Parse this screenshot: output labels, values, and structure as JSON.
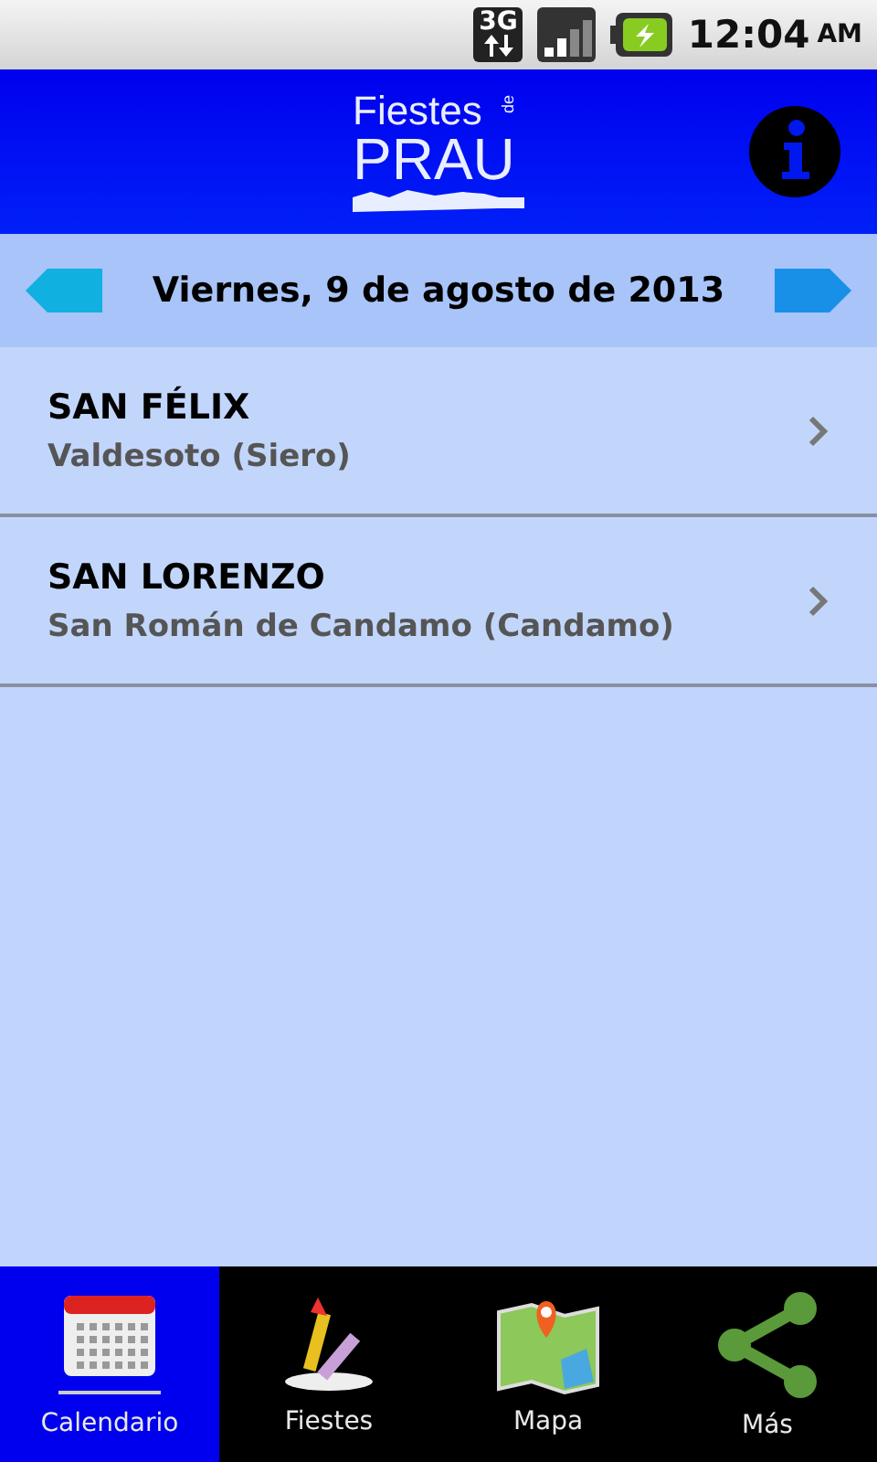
{
  "status_bar": {
    "network": "3G",
    "time": "12:04",
    "meridiem": "AM"
  },
  "header": {
    "logo": {
      "top": "Fiestes",
      "small": "de",
      "bottom": "PRAU"
    }
  },
  "date_bar": {
    "date": "Viernes, 9 de agosto de 2013"
  },
  "events": [
    {
      "name": "SAN FÉLIX",
      "place": "Valdesoto (Siero)"
    },
    {
      "name": "SAN LORENZO",
      "place": "San Román de Candamo (Candamo)"
    }
  ],
  "tabs": [
    {
      "kind": "calendar",
      "label": "Calendario",
      "selected": true
    },
    {
      "kind": "rocket",
      "label": "Fiestes",
      "selected": false
    },
    {
      "kind": "map",
      "label": "Mapa",
      "selected": false
    },
    {
      "kind": "share",
      "label": "Más",
      "selected": false
    }
  ]
}
